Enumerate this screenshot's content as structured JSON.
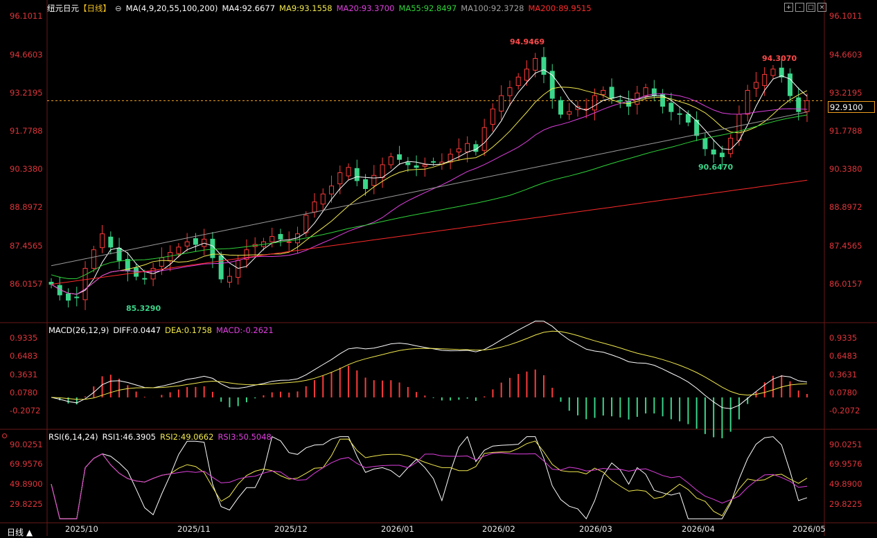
{
  "header": {
    "symbol": "纽元日元",
    "period_tag": "【日线】",
    "ma_params": "MA(4,9,20,55,100,200)",
    "ma4": "MA4:92.6677",
    "ma9": "MA9:93.1558",
    "ma20": "MA20:93.3700",
    "ma55": "MA55:92.8497",
    "ma100": "MA100:92.3728",
    "ma200": "MA200:89.9515"
  },
  "toolbar": {
    "buttons": [
      "+",
      "-",
      "□",
      "×"
    ]
  },
  "price_axis": {
    "ticks": [
      "96.1011",
      "94.6603",
      "93.2195",
      "91.7788",
      "90.3380",
      "88.8972",
      "87.4565",
      "86.0157"
    ],
    "current_price": "92.9100"
  },
  "annotations": {
    "high": "94.9469",
    "high2": "94.3070",
    "low": "85.3290",
    "low2": "90.6470"
  },
  "macd": {
    "title": "MACD(26,12,9)",
    "diff": "DIFF:0.0447",
    "dea": "DEA:0.1758",
    "macd": "MACD:-0.2621",
    "ticks": [
      "0.9335",
      "0.6483",
      "0.3631",
      "0.0780",
      "-0.2072"
    ]
  },
  "rsi": {
    "title": "RSI(6,14,24)",
    "rsi1": "RSI1:46.3905",
    "rsi2": "RSI2:49.0662",
    "rsi3": "RSI3:50.5048",
    "ticks": [
      "90.0251",
      "69.9576",
      "49.8900",
      "29.8225"
    ]
  },
  "x_axis": {
    "labels": [
      "2025/10",
      "2025/11",
      "2025/12",
      "2026/01",
      "2026/02",
      "2026/03",
      "2026/04",
      "2026/05"
    ]
  },
  "period_selector": "日线 ▲",
  "colors": {
    "background": "#000000",
    "up": "#ff3b3b",
    "down": "#3bd68a",
    "ma4": "#ffffff",
    "ma9": "#f2e94e",
    "ma20": "#e040e0",
    "ma55": "#2fd43a",
    "ma100": "#9a9a9a",
    "ma200": "#ff2a2a",
    "axis_text": "#e0343a"
  },
  "chart_data": {
    "type": "candlestick",
    "title": "纽元日元 日线",
    "y_range": [
      85.0,
      96.3
    ],
    "series": [
      {
        "name": "MA4",
        "value": 92.6677
      },
      {
        "name": "MA9",
        "value": 93.1558
      },
      {
        "name": "MA20",
        "value": 93.37
      },
      {
        "name": "MA55",
        "value": 92.8497
      },
      {
        "name": "MA100",
        "value": 92.3728
      },
      {
        "name": "MA200",
        "value": 89.9515
      }
    ],
    "close_approx": [
      86.0,
      85.6,
      85.4,
      85.5,
      86.6,
      87.3,
      87.9,
      87.4,
      86.9,
      86.5,
      86.3,
      86.2,
      86.6,
      87.0,
      87.2,
      87.4,
      87.6,
      87.5,
      87.7,
      87.0,
      86.2,
      86.3,
      86.9,
      87.3,
      87.5,
      87.6,
      87.8,
      87.7,
      87.6,
      87.9,
      88.6,
      89.1,
      89.4,
      89.7,
      90.2,
      90.4,
      89.9,
      89.6,
      90.1,
      90.5,
      90.8,
      90.7,
      90.5,
      90.4,
      90.5,
      90.6,
      90.6,
      90.9,
      91.1,
      91.3,
      91.0,
      91.9,
      92.6,
      93.1,
      93.4,
      93.8,
      94.1,
      94.5,
      93.9,
      93.0,
      92.4,
      92.5,
      92.7,
      92.6,
      93.1,
      93.3,
      93.0,
      92.9,
      92.7,
      93.2,
      93.4,
      93.1,
      92.7,
      92.5,
      92.4,
      92.1,
      91.6,
      91.1,
      90.9,
      90.8,
      91.5,
      92.4,
      93.3,
      93.6,
      93.9,
      94.1,
      93.8,
      93.1,
      92.5,
      92.91
    ],
    "annotations": [
      {
        "label": "94.9469",
        "type": "high"
      },
      {
        "label": "94.3070",
        "type": "high"
      },
      {
        "label": "85.3290",
        "type": "low"
      },
      {
        "label": "90.6470",
        "type": "low"
      }
    ]
  }
}
